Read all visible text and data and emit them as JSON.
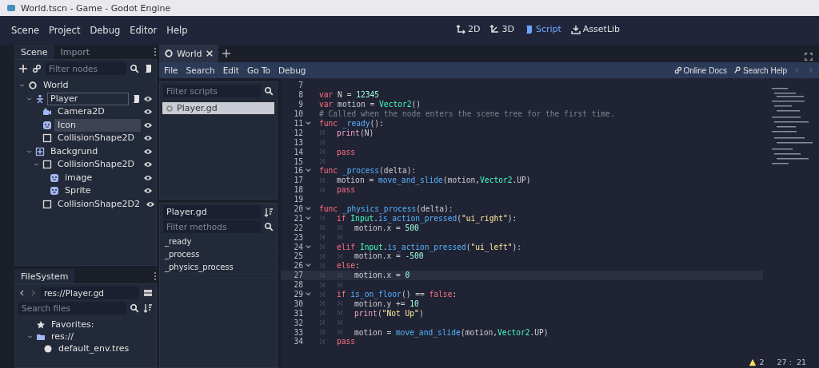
{
  "window": {
    "title": "World.tscn - Game - Godot Engine"
  },
  "menu": [
    "Scene",
    "Project",
    "Debug",
    "Editor",
    "Help"
  ],
  "workspaces": [
    {
      "label": "2D",
      "kind": "flat",
      "selected": false
    },
    {
      "label": "3D",
      "kind": "space",
      "selected": false
    },
    {
      "label": "Script",
      "kind": "script",
      "selected": true
    },
    {
      "label": "AssetLib",
      "kind": "assetlib",
      "selected": false
    }
  ],
  "scene_dock": {
    "tabs": [
      {
        "label": "Scene",
        "selected": true
      },
      {
        "label": "Import",
        "selected": false
      }
    ],
    "filter": {
      "placeholder": "Filter nodes"
    },
    "tree": [
      {
        "name": "World",
        "kind": "node2d",
        "expanded": true,
        "selected": false,
        "focused": false,
        "children": [
          {
            "name": "Player",
            "kind": "body",
            "expanded": true,
            "selected": false,
            "focused": true,
            "script": true,
            "visible": true,
            "children": [
              {
                "name": "Camera2D",
                "kind": "camera",
                "selected": false,
                "focused": false,
                "visible": true
              },
              {
                "name": "Icon",
                "kind": "sprite",
                "selected": true,
                "focused": false,
                "visible": true
              },
              {
                "name": "CollisionShape2D",
                "kind": "shape",
                "selected": false,
                "focused": false,
                "visible": true
              }
            ]
          },
          {
            "name": "Backgrund",
            "kind": "static",
            "expanded": true,
            "selected": false,
            "focused": false,
            "visible": true,
            "children": [
              {
                "name": "CollisionShape2D",
                "kind": "shape",
                "expanded": true,
                "selected": false,
                "focused": false,
                "visible": true,
                "children": [
                  {
                    "name": "image",
                    "kind": "sprite",
                    "selected": false,
                    "focused": false,
                    "visible": true
                  },
                  {
                    "name": "Sprite",
                    "kind": "sprite",
                    "selected": false,
                    "focused": false,
                    "visible": true
                  }
                ]
              },
              {
                "name": "CollisionShape2D2",
                "kind": "shape",
                "selected": false,
                "focused": false,
                "visible": true
              }
            ]
          }
        ]
      }
    ]
  },
  "filesystem": {
    "tab": "FileSystem",
    "path": "res://Player.gd",
    "search": {
      "placeholder": "Search files"
    },
    "tree": [
      {
        "name": "Favorites:",
        "kind": "favorites"
      },
      {
        "name": "res://",
        "kind": "folder",
        "expanded": true,
        "children": [
          {
            "name": "default_env.tres",
            "kind": "resource"
          }
        ]
      }
    ]
  },
  "script_tabs": [
    {
      "label": "World",
      "selected": true
    }
  ],
  "script_menu": [
    "File",
    "Search",
    "Edit",
    "Go To",
    "Debug"
  ],
  "help_links": [
    {
      "label": "Online Docs",
      "kind": "docs"
    },
    {
      "label": "Search Help",
      "kind": "help"
    }
  ],
  "scripts": {
    "filter": {
      "placeholder": "Filter scripts"
    },
    "items": [
      {
        "name": "Player.gd",
        "selected": true
      }
    ]
  },
  "methods": {
    "title": "Player.gd",
    "filter": {
      "placeholder": "Filter methods"
    },
    "items": [
      "_ready",
      "_process",
      "_physics_process"
    ]
  },
  "code": [
    {
      "n": "7",
      "fold": false,
      "current": false
    },
    {
      "n": "8",
      "fold": false,
      "current": false,
      "tokens": [
        {
          "kind": "keyword",
          "text": "var"
        },
        {
          "kind": "plain",
          "text": " N = "
        },
        {
          "kind": "number",
          "text": "12345"
        }
      ]
    },
    {
      "n": "9",
      "fold": false,
      "current": false,
      "tokens": [
        {
          "kind": "keyword",
          "text": "var"
        },
        {
          "kind": "plain",
          "text": " motion = "
        },
        {
          "kind": "type",
          "text": "Vector2"
        },
        {
          "kind": "plain",
          "text": "()"
        }
      ]
    },
    {
      "n": "10",
      "fold": false,
      "current": false,
      "tokens": [
        {
          "kind": "comment",
          "text": "# Called when the node enters the scene tree for the first time."
        }
      ]
    },
    {
      "n": "11",
      "fold": true,
      "current": false,
      "tokens": [
        {
          "kind": "keyword",
          "text": "func"
        },
        {
          "kind": "function",
          "text": " _ready"
        },
        {
          "kind": "plain",
          "text": "():"
        }
      ]
    },
    {
      "n": "12",
      "fold": false,
      "current": false,
      "tokens": [
        {
          "kind": "tab"
        },
        {
          "kind": "builtin",
          "text": "print"
        },
        {
          "kind": "plain",
          "text": "(N)"
        }
      ]
    },
    {
      "n": "13",
      "fold": false,
      "current": false,
      "tokens": [
        {
          "kind": "tab"
        }
      ]
    },
    {
      "n": "14",
      "fold": false,
      "current": false,
      "tokens": [
        {
          "kind": "tab"
        },
        {
          "kind": "keyword",
          "text": "pass"
        }
      ]
    },
    {
      "n": "15",
      "fold": false,
      "current": false,
      "tokens": [
        {
          "kind": "tab"
        }
      ]
    },
    {
      "n": "16",
      "fold": true,
      "current": false,
      "tokens": [
        {
          "kind": "keyword",
          "text": "func"
        },
        {
          "kind": "function",
          "text": " _process"
        },
        {
          "kind": "plain",
          "text": "(delta):"
        }
      ]
    },
    {
      "n": "17",
      "fold": false,
      "current": false,
      "tokens": [
        {
          "kind": "tab"
        },
        {
          "kind": "plain",
          "text": "motion = "
        },
        {
          "kind": "function",
          "text": "move_and_slide"
        },
        {
          "kind": "plain",
          "text": "(motion,"
        },
        {
          "kind": "type",
          "text": "Vector2"
        },
        {
          "kind": "plain",
          "text": ".UP)"
        }
      ]
    },
    {
      "n": "18",
      "fold": false,
      "current": false,
      "tokens": [
        {
          "kind": "tab"
        },
        {
          "kind": "keyword",
          "text": "pass"
        }
      ]
    },
    {
      "n": "19",
      "fold": false,
      "current": false
    },
    {
      "n": "20",
      "fold": true,
      "current": false,
      "tokens": [
        {
          "kind": "keyword",
          "text": "func"
        },
        {
          "kind": "function",
          "text": " _physics_process"
        },
        {
          "kind": "plain",
          "text": "(delta):"
        }
      ]
    },
    {
      "n": "21",
      "fold": true,
      "current": false,
      "tokens": [
        {
          "kind": "tab"
        },
        {
          "kind": "keyword",
          "text": "if"
        },
        {
          "kind": "type",
          "text": " Input"
        },
        {
          "kind": "plain",
          "text": "."
        },
        {
          "kind": "function",
          "text": "is_action_pressed"
        },
        {
          "kind": "plain",
          "text": "("
        },
        {
          "kind": "string",
          "text": "\"ui_right\""
        },
        {
          "kind": "plain",
          "text": "):"
        }
      ]
    },
    {
      "n": "22",
      "fold": false,
      "current": false,
      "tokens": [
        {
          "kind": "tab"
        },
        {
          "kind": "tab"
        },
        {
          "kind": "plain",
          "text": "motion.x = "
        },
        {
          "kind": "number",
          "text": "500"
        }
      ]
    },
    {
      "n": "23",
      "fold": false,
      "current": false,
      "tokens": [
        {
          "kind": "tab"
        },
        {
          "kind": "tab"
        }
      ]
    },
    {
      "n": "24",
      "fold": true,
      "current": false,
      "tokens": [
        {
          "kind": "tab"
        },
        {
          "kind": "keyword",
          "text": "elif"
        },
        {
          "kind": "type",
          "text": " Input"
        },
        {
          "kind": "plain",
          "text": "."
        },
        {
          "kind": "function",
          "text": "is_action_pressed"
        },
        {
          "kind": "plain",
          "text": "("
        },
        {
          "kind": "string",
          "text": "\"ui_left\""
        },
        {
          "kind": "plain",
          "text": "):"
        }
      ]
    },
    {
      "n": "25",
      "fold": false,
      "current": false,
      "tokens": [
        {
          "kind": "tab"
        },
        {
          "kind": "tab"
        },
        {
          "kind": "plain",
          "text": "motion.x = "
        },
        {
          "kind": "number",
          "text": "-500"
        }
      ]
    },
    {
      "n": "26",
      "fold": true,
      "current": false,
      "tokens": [
        {
          "kind": "tab"
        },
        {
          "kind": "keyword",
          "text": "else"
        },
        {
          "kind": "plain",
          "text": ":"
        }
      ]
    },
    {
      "n": "27",
      "fold": false,
      "current": true,
      "tokens": [
        {
          "kind": "tab"
        },
        {
          "kind": "tab"
        },
        {
          "kind": "plain",
          "text": "motion.x = "
        },
        {
          "kind": "number",
          "text": "0"
        }
      ]
    },
    {
      "n": "28",
      "fold": false,
      "current": false,
      "tokens": [
        {
          "kind": "tab"
        },
        {
          "kind": "tab"
        }
      ]
    },
    {
      "n": "29",
      "fold": true,
      "current": false,
      "tokens": [
        {
          "kind": "tab"
        },
        {
          "kind": "keyword",
          "text": "if"
        },
        {
          "kind": "function",
          "text": " is_on_floor"
        },
        {
          "kind": "plain",
          "text": "() == "
        },
        {
          "kind": "keyword",
          "text": "false"
        },
        {
          "kind": "plain",
          "text": ":"
        }
      ]
    },
    {
      "n": "30",
      "fold": false,
      "current": false,
      "tokens": [
        {
          "kind": "tab"
        },
        {
          "kind": "tab"
        },
        {
          "kind": "plain",
          "text": "motion.y += "
        },
        {
          "kind": "number",
          "text": "10"
        }
      ]
    },
    {
      "n": "31",
      "fold": false,
      "current": false,
      "tokens": [
        {
          "kind": "tab"
        },
        {
          "kind": "tab"
        },
        {
          "kind": "builtin",
          "text": "print"
        },
        {
          "kind": "plain",
          "text": "("
        },
        {
          "kind": "string",
          "text": "\"Not Up\""
        },
        {
          "kind": "plain",
          "text": ")"
        }
      ]
    },
    {
      "n": "32",
      "fold": false,
      "current": false,
      "tokens": [
        {
          "kind": "tab"
        },
        {
          "kind": "tab"
        }
      ]
    },
    {
      "n": "33",
      "fold": false,
      "current": false,
      "tokens": [
        {
          "kind": "tab"
        },
        {
          "kind": "tab"
        },
        {
          "kind": "plain",
          "text": "motion = "
        },
        {
          "kind": "function",
          "text": "move_and_slide"
        },
        {
          "kind": "plain",
          "text": "(motion,"
        },
        {
          "kind": "type",
          "text": "Vector2"
        },
        {
          "kind": "plain",
          "text": ".UP)"
        }
      ]
    },
    {
      "n": "34",
      "fold": false,
      "current": false,
      "tokens": [
        {
          "kind": "tab"
        },
        {
          "kind": "keyword",
          "text": "pass"
        }
      ]
    }
  ],
  "status": {
    "warnings": "2",
    "position": "27 :  21"
  }
}
